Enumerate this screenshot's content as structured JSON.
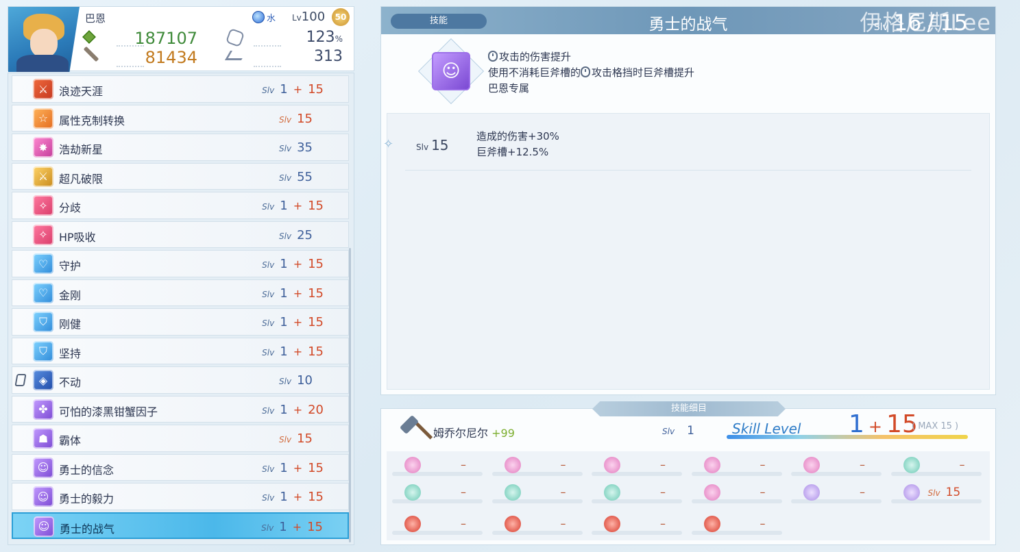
{
  "character": {
    "name": "巴恩",
    "element": "水",
    "level_prefix": "Lv",
    "level": "100",
    "level_badge": "50",
    "hp": "187107",
    "atk": "81434",
    "crit": "123",
    "crit_unit": "%",
    "speed": "313"
  },
  "skills": [
    {
      "name": "浪迹天涯",
      "slv_tag": "Slv",
      "base": "1",
      "plus": "+",
      "bonus": "15",
      "icon": "sword-icon",
      "color": "red"
    },
    {
      "name": "属性克制转换",
      "slv_tag": "Slv",
      "base": "15",
      "plus": "",
      "bonus": "",
      "icon": "star-icon",
      "color": "orange",
      "max": true
    },
    {
      "name": "浩劫新星",
      "slv_tag": "Slv",
      "base": "35",
      "plus": "",
      "bonus": "",
      "icon": "burst-icon",
      "color": "pink"
    },
    {
      "name": "超凡破限",
      "slv_tag": "Slv",
      "base": "55",
      "plus": "",
      "bonus": "",
      "icon": "sword-icon",
      "color": "gold"
    },
    {
      "name": "分歧",
      "slv_tag": "Slv",
      "base": "1",
      "plus": "+",
      "bonus": "15",
      "icon": "sparkle-icon",
      "color": "rose"
    },
    {
      "name": "HP吸收",
      "slv_tag": "Slv",
      "base": "25",
      "plus": "",
      "bonus": "",
      "icon": "sparkle-icon",
      "color": "rose"
    },
    {
      "name": "守护",
      "slv_tag": "Slv",
      "base": "1",
      "plus": "+",
      "bonus": "15",
      "icon": "heart-icon",
      "color": "blue"
    },
    {
      "name": "金刚",
      "slv_tag": "Slv",
      "base": "1",
      "plus": "+",
      "bonus": "15",
      "icon": "heart-icon",
      "color": "blue"
    },
    {
      "name": "刚健",
      "slv_tag": "Slv",
      "base": "1",
      "plus": "+",
      "bonus": "15",
      "icon": "shield-icon",
      "color": "blue"
    },
    {
      "name": "坚持",
      "slv_tag": "Slv",
      "base": "1",
      "plus": "+",
      "bonus": "15",
      "icon": "shield-icon",
      "color": "blue"
    },
    {
      "name": "不动",
      "slv_tag": "Slv",
      "base": "10",
      "plus": "",
      "bonus": "",
      "icon": "diamond-icon",
      "color": "navy",
      "locked": true
    },
    {
      "name": "可怕的漆黑钳蟹因子",
      "slv_tag": "Slv",
      "base": "1",
      "plus": "+",
      "bonus": "20",
      "icon": "crab-icon",
      "color": "purple"
    },
    {
      "name": "霸体",
      "slv_tag": "Slv",
      "base": "15",
      "plus": "",
      "bonus": "",
      "icon": "armor-icon",
      "color": "purple",
      "max": true
    },
    {
      "name": "勇士的信念",
      "slv_tag": "Slv",
      "base": "1",
      "plus": "+",
      "bonus": "15",
      "icon": "hero-icon",
      "color": "purple"
    },
    {
      "name": "勇士的毅力",
      "slv_tag": "Slv",
      "base": "1",
      "plus": "+",
      "bonus": "15",
      "icon": "hero-icon",
      "color": "purple"
    },
    {
      "name": "勇士的战气",
      "slv_tag": "Slv",
      "base": "1",
      "plus": "+",
      "bonus": "15",
      "icon": "hero-icon",
      "color": "purple",
      "active": true
    }
  ],
  "detail": {
    "tag": "技能",
    "title": "勇士的战气",
    "slv_label": "Slv",
    "slv_current": "16",
    "slv_sep": "/",
    "slv_max": "15",
    "watermark": "伊格尼斯Lee",
    "desc_line1": "攻击的伤害提升",
    "desc_line2a": "使用不消耗巨斧槽的",
    "desc_line2b": "攻击格挡时巨斧槽提升",
    "desc_line3": "巴恩专属",
    "level_rows": [
      {
        "slv_tag": "Slv",
        "slv": "15",
        "effect1": "造成的伤害+30%",
        "effect2": "巨斧槽+12.5%"
      }
    ]
  },
  "breakdown": {
    "tab": "技能细目",
    "weapon_name": "姆乔尔尼尔",
    "weapon_plus": "+99",
    "weapon_slv_tag": "Slv",
    "weapon_slv": "1",
    "skill_level_label": "Skill Level",
    "skill_level_base": "1",
    "skill_level_plus": "+",
    "skill_level_bonus": "15",
    "skill_level_max": "( MAX 15 )",
    "mods": [
      [
        {
          "icon": "pink",
          "text": "–"
        },
        {
          "icon": "pink",
          "text": "–"
        },
        {
          "icon": "pink",
          "text": "–"
        },
        {
          "icon": "pink",
          "text": "–"
        },
        {
          "icon": "pink",
          "text": "–"
        },
        {
          "icon": "cyan",
          "text": "–"
        }
      ],
      [
        {
          "icon": "cyan",
          "text": "–"
        },
        {
          "icon": "cyan",
          "text": "–"
        },
        {
          "icon": "cyan",
          "text": "–"
        },
        {
          "icon": "pink",
          "text": "–"
        },
        {
          "icon": "lilac",
          "text": "–"
        },
        {
          "icon": "lilac",
          "text": "",
          "slv_tag": "Slv",
          "slv": "15"
        }
      ],
      [
        {
          "icon": "red",
          "text": "–"
        },
        {
          "icon": "red",
          "text": "–"
        },
        {
          "icon": "red",
          "text": "–"
        },
        {
          "icon": "red",
          "text": "–"
        }
      ]
    ]
  },
  "colors": {
    "accent_blue": "#2f6fd0",
    "bonus_red": "#d24a28",
    "hp_green": "#3f8a3a",
    "atk_orange": "#c27a1e",
    "active_row": "#4bb8ea"
  }
}
